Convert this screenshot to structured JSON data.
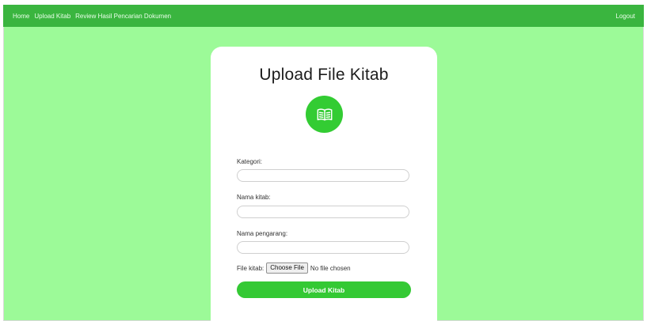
{
  "nav": {
    "items": [
      {
        "label": "Home"
      },
      {
        "label": "Upload Kitab"
      },
      {
        "label": "Review Hasil Pencarian Dokumen"
      }
    ],
    "logout_label": "Logout"
  },
  "colors": {
    "navbar": "#3ab53f",
    "page_background": "#9cfa98",
    "accent": "#33cc33"
  },
  "form": {
    "title": "Upload File Kitab",
    "icon": "book-icon",
    "fields": {
      "kategori": {
        "label": "Kategori:",
        "value": ""
      },
      "nama_kitab": {
        "label": "Nama kitab:",
        "value": ""
      },
      "nama_pengarang": {
        "label": "Nama pengarang:",
        "value": ""
      }
    },
    "file": {
      "label": "File kitab:",
      "button_label": "Choose File",
      "status": "No file chosen"
    },
    "submit_label": "Upload Kitab"
  }
}
